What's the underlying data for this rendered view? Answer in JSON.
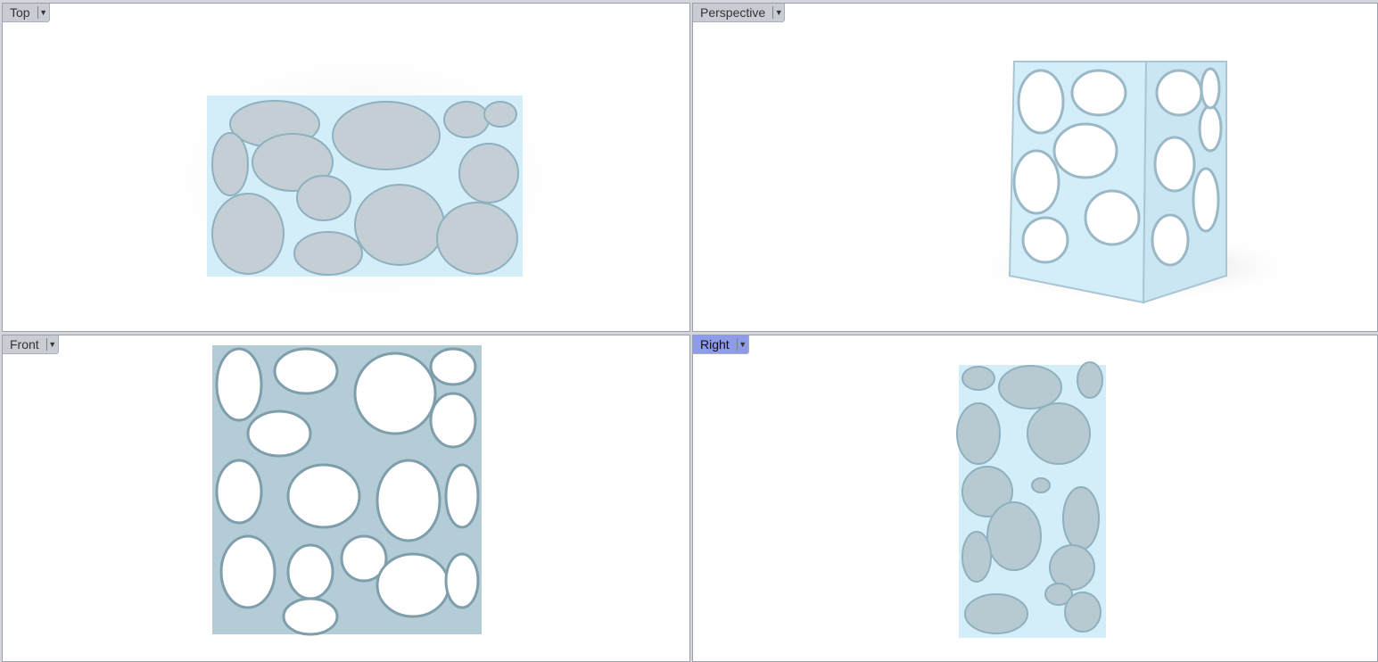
{
  "viewports": {
    "top": {
      "label": "Top",
      "active": false
    },
    "perspective": {
      "label": "Perspective",
      "active": false
    },
    "front": {
      "label": "Front",
      "active": false
    },
    "right": {
      "label": "Right",
      "active": true
    }
  },
  "icons": {
    "viewport_menu": "triangle-down"
  },
  "colors": {
    "panel_background": "#ffffff",
    "frame": "#d4d6dc",
    "model_fill": "#d3eef9",
    "model_shadow": "#a9c6d2",
    "active_tab": "#8d9be8",
    "inactive_tab": "#c9ccd3"
  }
}
